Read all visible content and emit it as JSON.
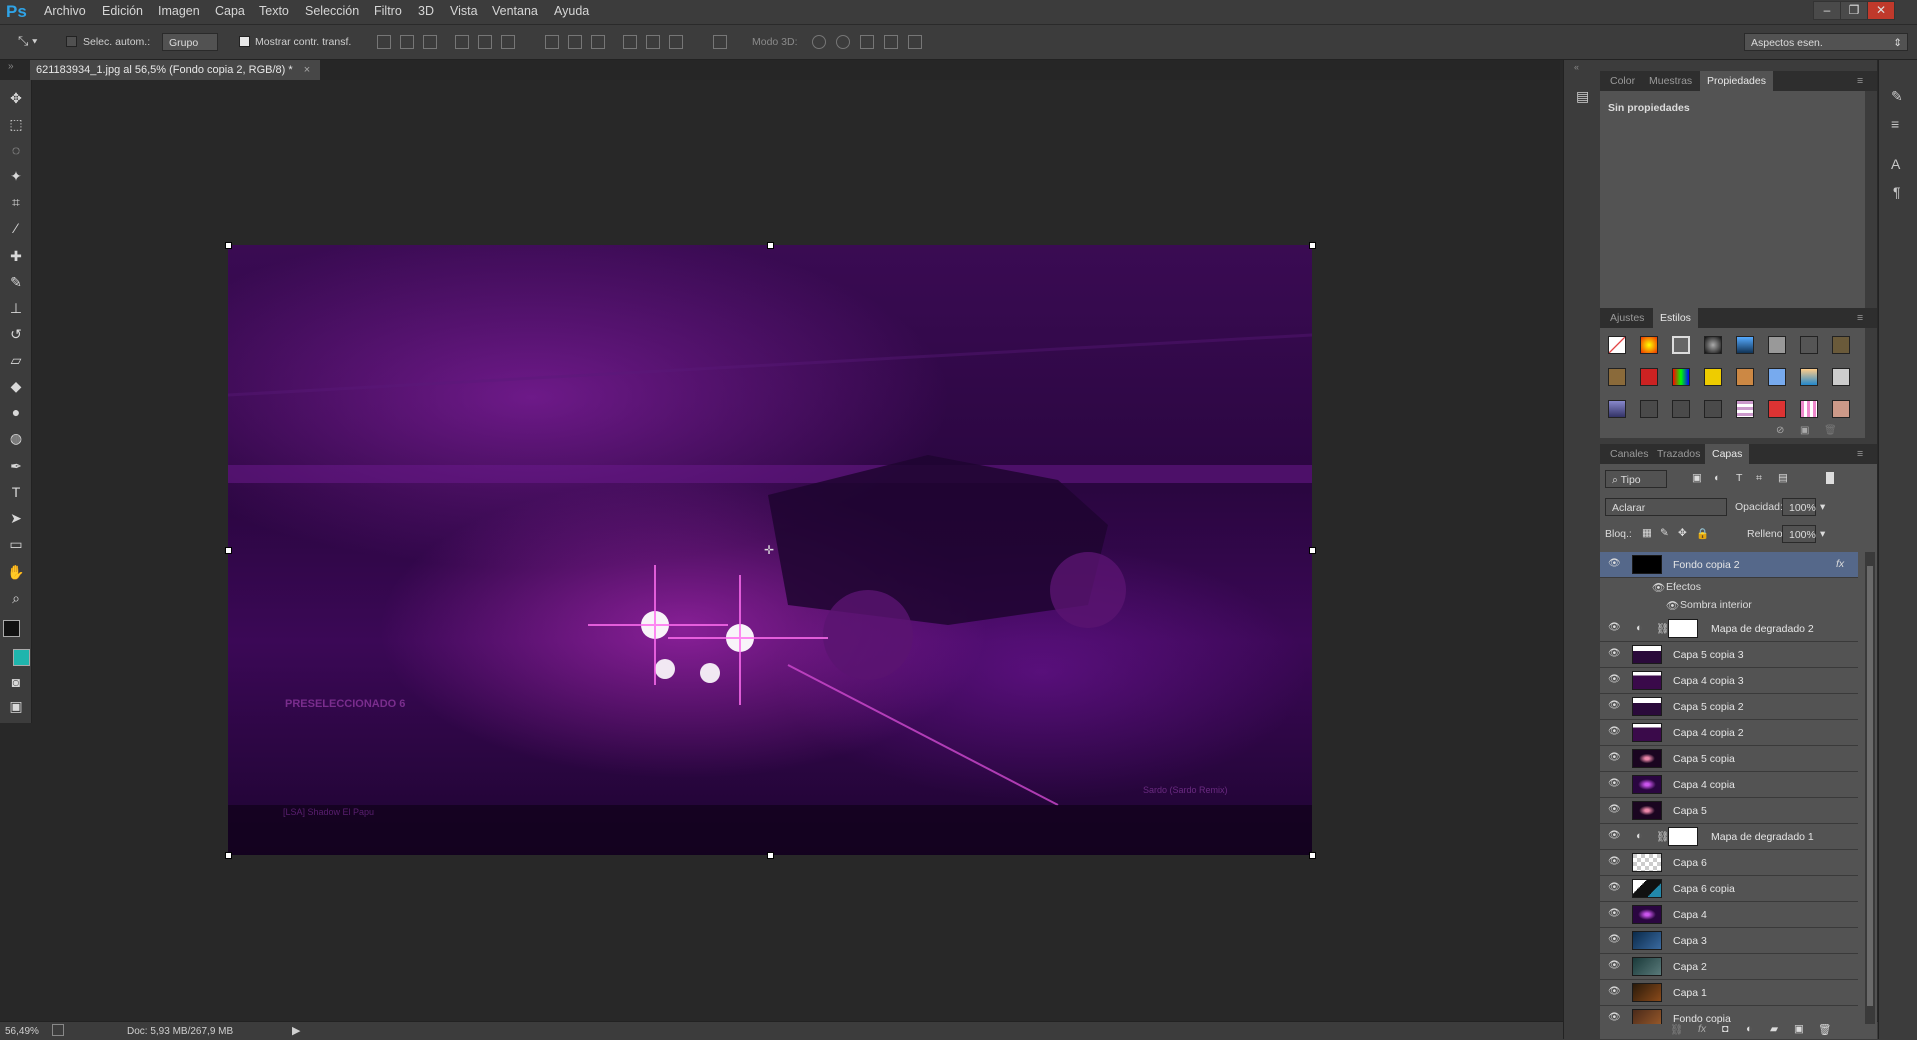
{
  "menubar": {
    "logo": "Ps",
    "items": [
      "Archivo",
      "Edición",
      "Imagen",
      "Capa",
      "Texto",
      "Selección",
      "Filtro",
      "3D",
      "Vista",
      "Ventana",
      "Ayuda"
    ],
    "window_controls": [
      "–",
      "❐",
      "✕"
    ]
  },
  "options": {
    "auto_select_label": "Selec. autom.:",
    "auto_select_value": "Grupo",
    "show_transform_label": "Mostrar contr. transf.",
    "mode3d_label": "Modo 3D:",
    "workspace": "Aspectos esen."
  },
  "document": {
    "tab_title": "621183934_1.jpg al 56,5% (Fondo copia 2, RGB/8) *",
    "close": "×"
  },
  "image_text": {
    "heading": "PRESELECCIONADO 6",
    "footer": "Sardo (Sardo Remix)",
    "tag": "[LSA] Shadow El Papu"
  },
  "status": {
    "zoom": "56,49%",
    "doc": "Doc: 5,93 MB/267,9 MB"
  },
  "properties_panel": {
    "tabs": [
      "Color",
      "Muestras",
      "Propiedades"
    ],
    "active_tab": "Propiedades",
    "content": "Sin propiedades"
  },
  "styles_panel": {
    "tabs": [
      "Ajustes",
      "Estilos"
    ],
    "active_tab": "Estilos"
  },
  "layers_panel": {
    "tabs": [
      "Canales",
      "Trazados",
      "Capas"
    ],
    "active_tab": "Capas",
    "filter": "Tipo",
    "blend_mode": "Aclarar",
    "opacity_label": "Opacidad:",
    "opacity": "100%",
    "lock_label": "Bloq.:",
    "fill_label": "Relleno:",
    "fill": "100%",
    "effects_label": "Efectos",
    "effect_item": "Sombra interior",
    "fx": "fx",
    "layers": [
      "Fondo copia 2",
      "Mapa de degradado 2",
      "Capa 5 copia 3",
      "Capa 4 copia 3",
      "Capa 5 copia 2",
      "Capa 4 copia 2",
      "Capa 5 copia",
      "Capa 4 copia",
      "Capa 5",
      "Mapa de degradado 1",
      "Capa 6",
      "Capa 6 copia",
      "Capa 4",
      "Capa 3",
      "Capa 2",
      "Capa 1",
      "Fondo copia"
    ]
  },
  "colors": {
    "foreground": "#111111",
    "background": "#1fb5ad",
    "selected_layer": "#55688a"
  }
}
